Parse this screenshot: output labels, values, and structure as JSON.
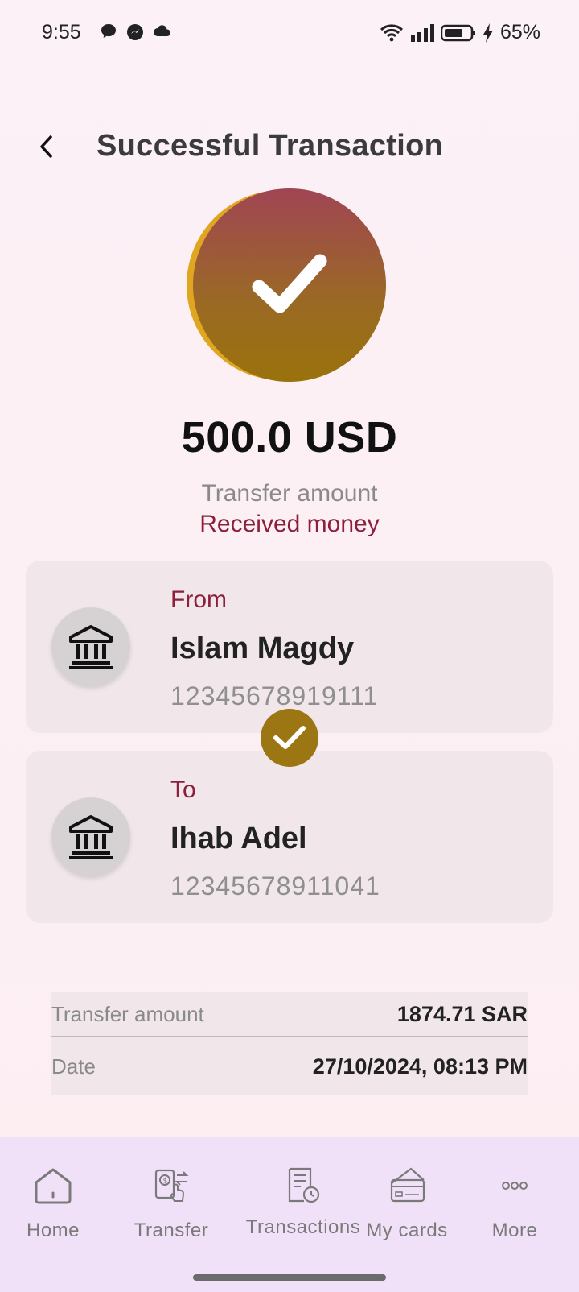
{
  "status_bar": {
    "time": "9:55",
    "battery": "65%",
    "icons_left": [
      "chat-icon",
      "messenger-icon",
      "cloud-icon"
    ],
    "icons_right": [
      "wifi-icon",
      "signal-icon",
      "battery-icon",
      "charging-icon"
    ]
  },
  "header": {
    "title": "Successful Transaction"
  },
  "summary": {
    "amount": "500.0 USD",
    "amount_label": "Transfer amount",
    "type_label": "Received money"
  },
  "from": {
    "role": "From",
    "name": "Islam Magdy",
    "account": "12345678919111"
  },
  "to": {
    "role": "To",
    "name": "Ihab Adel",
    "account": "12345678911041"
  },
  "details": [
    {
      "label": "Transfer amount",
      "value": "1874.71 SAR"
    },
    {
      "label": "Date",
      "value": "27/10/2024, 08:13 PM"
    }
  ],
  "nav": [
    {
      "label": "Home",
      "icon": "home-icon"
    },
    {
      "label": "Transfer",
      "icon": "transfer-icon"
    },
    {
      "label": "Transactions",
      "icon": "transactions-icon"
    },
    {
      "label": "My cards",
      "icon": "cards-icon"
    },
    {
      "label": "More",
      "icon": "more-icon"
    }
  ],
  "colors": {
    "accent": "#8c1f3c",
    "gold": "#9b7613",
    "card_bg": "#f1e7ea",
    "nav_bg": "#f1e1f8"
  }
}
